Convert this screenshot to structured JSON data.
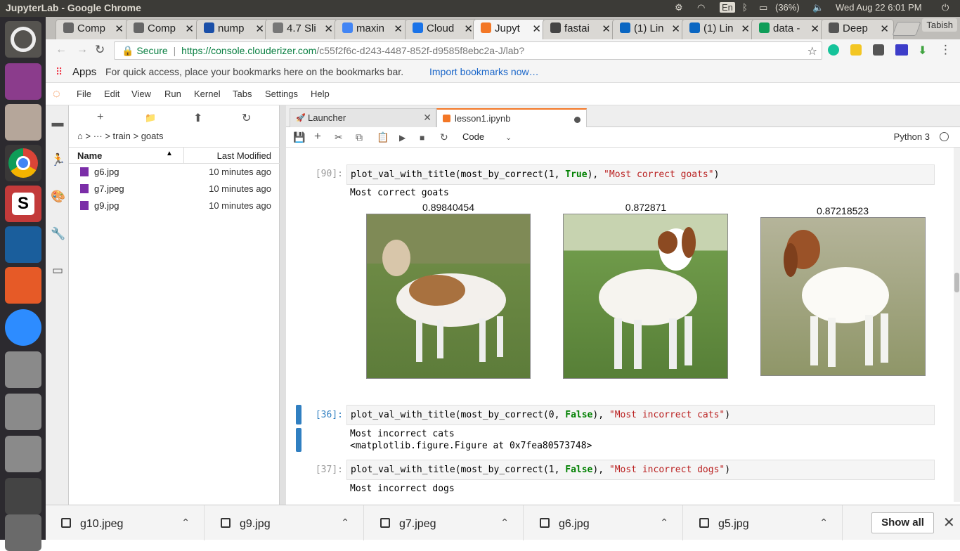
{
  "os": {
    "window_title": "JupyterLab - Google Chrome",
    "language": "En",
    "battery": "(36%)",
    "clock": "Wed Aug 22  6:01 PM"
  },
  "browser": {
    "tabs": [
      {
        "label": "Comp",
        "icon": "doc-icon"
      },
      {
        "label": "Comp",
        "icon": "doc-icon"
      },
      {
        "label": "nump",
        "icon": "s-icon"
      },
      {
        "label": "4.7 Sli",
        "icon": "apple-icon"
      },
      {
        "label": "maxin",
        "icon": "google-icon"
      },
      {
        "label": "Cloud",
        "icon": "cloud-icon"
      },
      {
        "label": "Jupyt",
        "icon": "jupyter-icon"
      },
      {
        "label": "fastai",
        "icon": "infinity-icon"
      },
      {
        "label": "(1) Lin",
        "icon": "linkedin-icon"
      },
      {
        "label": "(1) Lin",
        "icon": "linkedin-icon"
      },
      {
        "label": "data -",
        "icon": "drive-icon"
      },
      {
        "label": "Deep",
        "icon": "deep-icon"
      }
    ],
    "profile": "Tabish",
    "secure": "Secure",
    "url_host": "https://console.clouderizer.com",
    "url_path": "/c55f2f6c-d243-4487-852f-d9585f8ebc2a-J/lab?",
    "apps": "Apps",
    "bookmark_hint": "For quick access, place your bookmarks here on the bookmarks bar.",
    "import_link": "Import bookmarks now…"
  },
  "lab": {
    "menu": [
      "File",
      "Edit",
      "View",
      "Run",
      "Kernel",
      "Tabs",
      "Settings",
      "Help"
    ],
    "breadcrumb": {
      "dots": "···",
      "seg1": "train",
      "seg2": "goats",
      "sep": ">"
    },
    "file_columns": {
      "name": "Name",
      "modified": "Last Modified"
    },
    "files": [
      {
        "name": "g6.jpg",
        "modified": "10 minutes ago"
      },
      {
        "name": "g7.jpeg",
        "modified": "10 minutes ago"
      },
      {
        "name": "g9.jpg",
        "modified": "10 minutes ago"
      }
    ],
    "doc_tabs": [
      {
        "label": "Launcher"
      },
      {
        "label": "lesson1.ipynb"
      }
    ],
    "cell_type": "Code",
    "kernel": "Python 3"
  },
  "notebook": {
    "cell1": {
      "prompt": "[90]:",
      "fn": "plot_val_with_title(most_by_correct(1, ",
      "kw": "True",
      "mid": "), ",
      "str": "\"Most correct goats\"",
      "end": ")",
      "output_title": "Most correct goats",
      "plot_titles": [
        "0.89840454",
        "0.872871",
        "0.87218523"
      ]
    },
    "cell2": {
      "prompt": "[36]:",
      "fn": "plot_val_with_title(most_by_correct(0, ",
      "kw": "False",
      "mid": "), ",
      "str": "\"Most incorrect cats\"",
      "end": ")",
      "out1": "Most incorrect cats",
      "out2": "<matplotlib.figure.Figure at 0x7fea80573748>"
    },
    "cell3": {
      "prompt": "[37]:",
      "fn": "plot_val_with_title(most_by_correct(1, ",
      "kw": "False",
      "mid": "), ",
      "str": "\"Most incorrect dogs\"",
      "end": ")",
      "out1": "Most incorrect dogs"
    }
  },
  "downloads": {
    "items": [
      "g10.jpeg",
      "g9.jpg",
      "g7.jpeg",
      "g6.jpg",
      "g5.jpg"
    ],
    "show_all": "Show all"
  }
}
